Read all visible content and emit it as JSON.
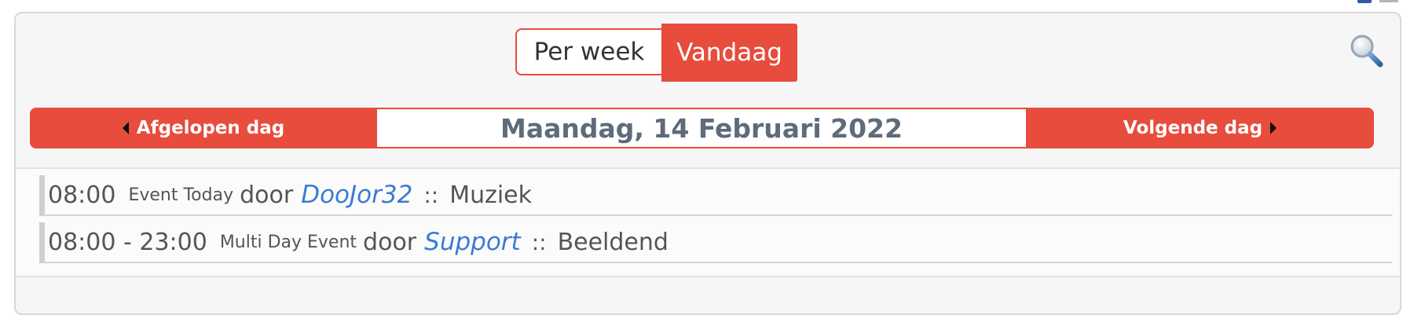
{
  "view_toggle": {
    "week_label": "Per week",
    "today_label": "Vandaag"
  },
  "search": {
    "icon": "magnifier-icon"
  },
  "nav": {
    "prev_label": "Afgelopen dag",
    "date": "Maandag, 14 Februari 2022",
    "next_label": "Volgende dag"
  },
  "events": [
    {
      "time": "08:00",
      "title": "Event Today",
      "door": "door",
      "author": "DooJor32",
      "separator": "::",
      "category": "Muziek"
    },
    {
      "time": "08:00 - 23:00",
      "title": "Multi Day Event",
      "door": "door",
      "author": "Support",
      "separator": "::",
      "category": "Beeldend"
    }
  ],
  "colors": {
    "accent": "#e74c3c",
    "link": "#3a7bd5",
    "date_text": "#5d6b7a"
  }
}
